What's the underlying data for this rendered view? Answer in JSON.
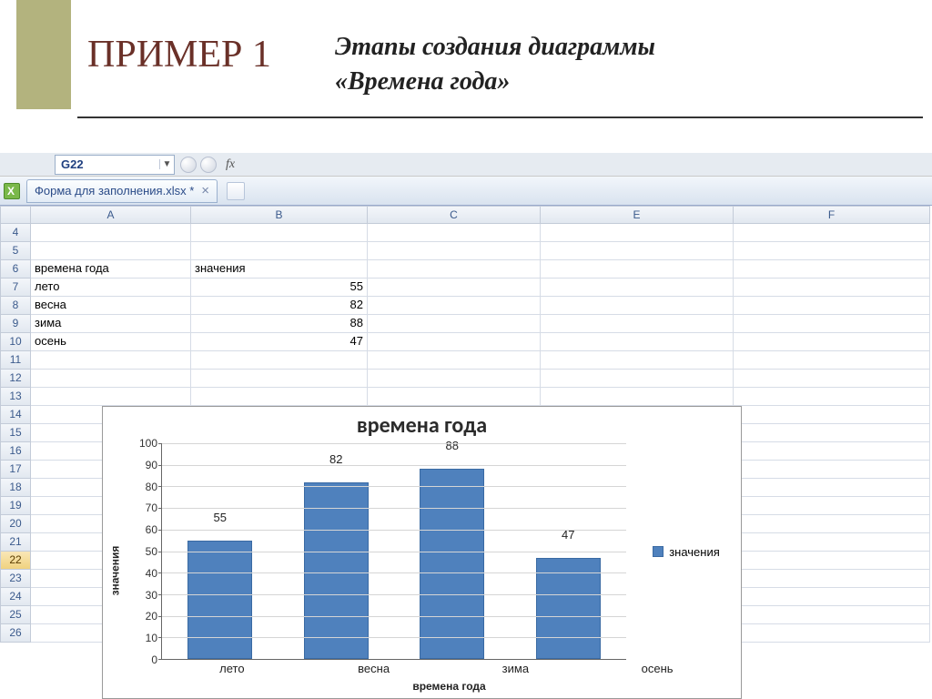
{
  "slide": {
    "title_main": "ПРИМЕР 1",
    "subtitle_line1": "Этапы создания диаграммы",
    "subtitle_line2": "«Времена года»"
  },
  "excel": {
    "namebox": "G22",
    "fx_label": "fx",
    "tab_name": "Форма для заполнения.xlsx *",
    "columns": [
      "A",
      "B",
      "C",
      "E",
      "F"
    ],
    "row_numbers": [
      "4",
      "5",
      "6",
      "7",
      "8",
      "9",
      "10",
      "11",
      "12",
      "13",
      "14",
      "15",
      "16",
      "17",
      "18",
      "19",
      "20",
      "21",
      "22",
      "23",
      "24",
      "25",
      "26"
    ],
    "selected_row": "22",
    "cells": {
      "A6": "времена года",
      "B6": "значения",
      "A7": "лето",
      "B7": "55",
      "A8": "весна",
      "B8": "82",
      "A9": "зима",
      "B9": "88",
      "A10": "осень",
      "B10": "47"
    }
  },
  "chart_data": {
    "type": "bar",
    "title": "времена года",
    "xlabel": "времена года",
    "ylabel": "значения",
    "categories": [
      "лето",
      "весна",
      "зима",
      "осень"
    ],
    "values": [
      55,
      82,
      88,
      47
    ],
    "ylim": [
      0,
      100
    ],
    "yticks": [
      0,
      10,
      20,
      30,
      40,
      50,
      60,
      70,
      80,
      90,
      100
    ],
    "legend": "значения",
    "bar_color": "#4f81bd"
  }
}
